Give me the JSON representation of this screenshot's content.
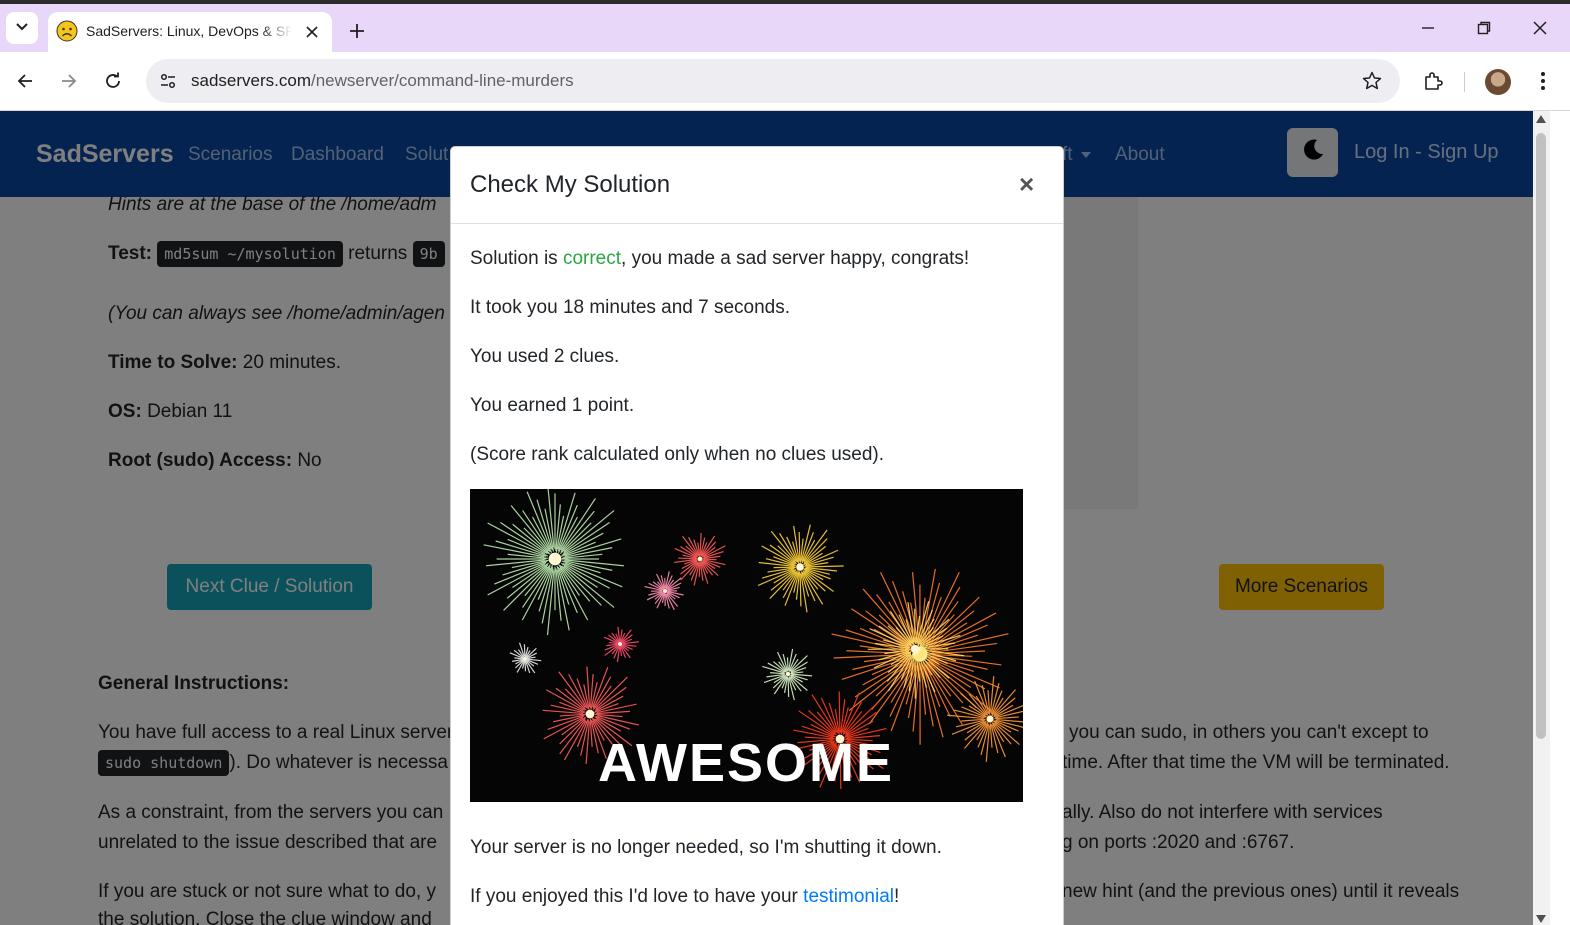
{
  "browser": {
    "tab_title": "SadServers: Linux, DevOps & SRE",
    "url_host": "sadservers.com",
    "url_path": "/newserver/command-line-murders",
    "colors": {
      "tabstrip": "#e9d7f9",
      "omnibox": "#eeeef2"
    }
  },
  "icons": [
    "tab-search-icon",
    "sad-face-icon",
    "close-icon",
    "plus-icon",
    "minimize-icon",
    "restore-icon",
    "window-close-icon",
    "back-arrow-icon",
    "forward-arrow-icon",
    "reload-icon",
    "site-info-icon",
    "star-icon",
    "extensions-icon",
    "avatar",
    "kebab-menu-icon",
    "moon-icon"
  ],
  "navbar": {
    "brand": "SadServers",
    "links": [
      "Scenarios",
      "Dashboard",
      "Solut",
      "ft",
      "About"
    ],
    "login": "Log In - Sign Up",
    "color": "#0b47a1"
  },
  "content": {
    "hints_text": "Hints are at the base of the /home/adm",
    "test_label": "Test:",
    "test_code": "md5sum ~/mysolution",
    "returns_text": "returns",
    "returns_code": "9b",
    "always_see": "(You can always see /home/admin/agen",
    "time_label": "Time to Solve:",
    "time_value": "20 minutes.",
    "os_label": "OS:",
    "os_value": "Debian 11",
    "root_label": "Root (sudo) Access:",
    "root_value": "No",
    "next_clue_button": "Next Clue / Solution",
    "more_scenarios_button": "More Scenarios",
    "general_title": "General Instructions:",
    "gi_left_1": "You have full access to a real Linux server",
    "gi_code": "sudo shutdown",
    "gi_left_2": "). Do whatever is necessa",
    "gi_right_1": "you can sudo, in others you can't except to",
    "gi_right_2": "time. After that time the VM will be terminated.",
    "gi_left_3": "As a constraint, from the servers you can",
    "gi_right_3": "ally. Also do not interfere with services",
    "gi_left_4": "unrelated to the issue described that are",
    "gi_right_4": "g on ports :2020 and :6767.",
    "gi_left_5": "If you are stuck or not sure what to do, y",
    "gi_right_5": "new hint (and the previous ones) until it reveals",
    "gi_left_6": "the solution. Close the clue window and",
    "colors": {
      "teal": "#17a2b8",
      "yellow": "#ffc107"
    }
  },
  "modal": {
    "title": "Check My Solution",
    "close_symbol": "×",
    "line1_prefix": "Solution is ",
    "line1_status": "correct",
    "line1_suffix": ", you made a sad server happy, congrats!",
    "line2": "It took you 18 minutes and 7 seconds.",
    "line3": "You used 2 clues.",
    "line4": "You earned 1 point.",
    "line5": "(Score rank calculated only when no clues used).",
    "image_text": "AWESOME",
    "line6": "Your server is no longer needed, so I'm shutting it down.",
    "line7_prefix": "If you enjoyed this I'd love to have your ",
    "line7_link": "testimonial",
    "line7_suffix": "!"
  }
}
